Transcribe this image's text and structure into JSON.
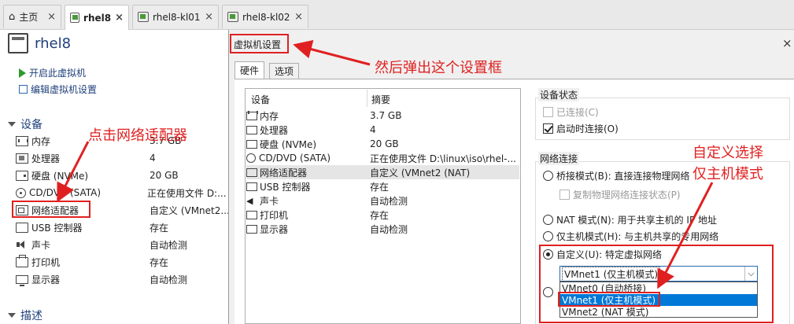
{
  "tabs": [
    {
      "label": "主页",
      "icon": "home-icon"
    },
    {
      "label": "rhel8",
      "icon": "vm-icon",
      "active": true
    },
    {
      "label": "rhel8-kl01",
      "icon": "vm-icon"
    },
    {
      "label": "rhel8-kl02",
      "icon": "vm-icon"
    }
  ],
  "left": {
    "vm_name": "rhel8",
    "actions": [
      "开启此虚拟机",
      "编辑虚拟机设置"
    ],
    "devices_section": "设备",
    "description_section": "描述",
    "devices": [
      {
        "name": "内存",
        "value": "3.7 GB",
        "icon": "memory-icon"
      },
      {
        "name": "处理器",
        "value": "4",
        "icon": "cpu-icon"
      },
      {
        "name": "硬盘 (NVMe)",
        "value": "20 GB",
        "icon": "disk-icon"
      },
      {
        "name": "CD/DVD (SATA)",
        "value": "正在使用文件 D:...",
        "icon": "cd-icon"
      },
      {
        "name": "网络适配器",
        "value": "自定义 (VMnet2...",
        "icon": "network-icon"
      },
      {
        "name": "USB 控制器",
        "value": "存在",
        "icon": "usb-icon"
      },
      {
        "name": "声卡",
        "value": "自动检测",
        "icon": "sound-icon"
      },
      {
        "name": "打印机",
        "value": "存在",
        "icon": "printer-icon"
      },
      {
        "name": "显示器",
        "value": "自动检测",
        "icon": "monitor-icon"
      }
    ]
  },
  "dialog": {
    "title": "虚拟机设置",
    "tabs": [
      "硬件",
      "选项"
    ],
    "list_header_device": "设备",
    "list_header_summary": "摘要",
    "devices": [
      {
        "name": "内存",
        "value": "3.7 GB"
      },
      {
        "name": "处理器",
        "value": "4"
      },
      {
        "name": "硬盘 (NVMe)",
        "value": "20 GB"
      },
      {
        "name": "CD/DVD (SATA)",
        "value": "正在使用文件 D:\\linux\\iso\\rhel-..."
      },
      {
        "name": "网络适配器",
        "value": "自定义 (VMnet2 (NAT)"
      },
      {
        "name": "USB 控制器",
        "value": "存在"
      },
      {
        "name": "声卡",
        "value": "自动检测"
      },
      {
        "name": "打印机",
        "value": "存在"
      },
      {
        "name": "显示器",
        "value": "自动检测"
      }
    ],
    "device_status": {
      "label": "设备状态",
      "connected": "已连接(C)",
      "connect_at_power_on": "启动时连接(O)"
    },
    "network": {
      "label": "网络连接",
      "bridged": "桥接模式(B): 直接连接物理网络",
      "replicate": "复制物理网络连接状态(P)",
      "nat": "NAT 模式(N): 用于共享主机的 IP 地址",
      "hostonly": "仅主机模式(H): 与主机共享的专用网络",
      "custom": "自定义(U): 特定虚拟网络",
      "selected": "VMnet1 (仅主机模式)",
      "options": [
        "VMnet0 (自动桥接)",
        "VMnet1 (仅主机模式)",
        "VMnet2 (NAT 模式)"
      ]
    }
  },
  "annotations": {
    "click_adapter": "点击网络适配器",
    "popup": "然后弹出这个设置框",
    "custom_line1": "自定义选择",
    "custom_line2": "仅主机模式"
  },
  "colors": {
    "annotation": "#e02020",
    "selection": "#0078d7",
    "title_blue": "#1f3f7a"
  }
}
